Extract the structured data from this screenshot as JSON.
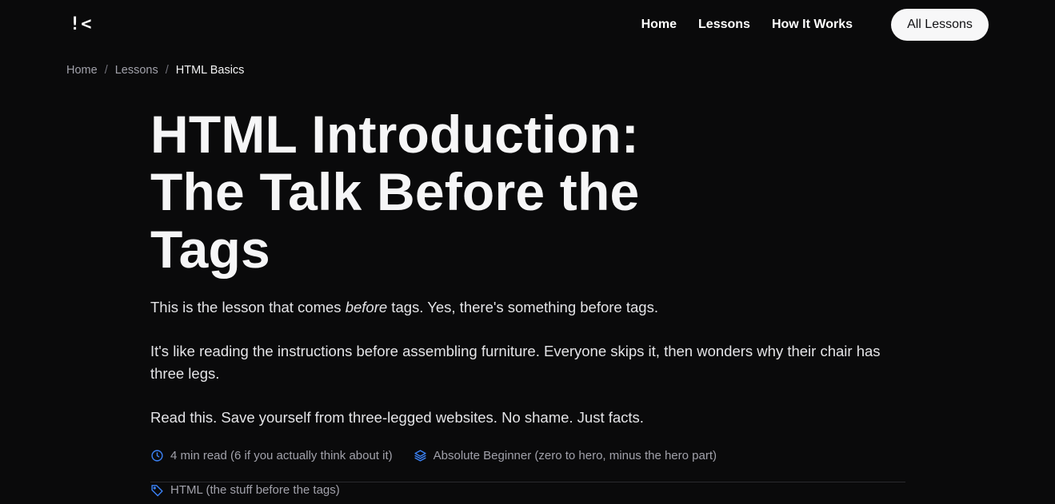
{
  "header": {
    "logo_text": "!<",
    "nav": [
      "Home",
      "Lessons",
      "How It Works"
    ],
    "cta_label": "All Lessons"
  },
  "breadcrumb": {
    "items": [
      "Home",
      "Lessons"
    ],
    "current": "HTML Basics"
  },
  "article": {
    "title": "HTML Introduction: The Talk Before the Tags",
    "intro": {
      "p1_before": "This is the lesson that comes ",
      "p1_em": "before",
      "p1_after": " tags. Yes, there's something before tags.",
      "p2": "It's like reading the instructions before assembling furniture. Everyone skips it, then wonders why their chair has three legs.",
      "p3": "Read this. Save yourself from three-legged websites. No shame. Just facts."
    },
    "meta": {
      "read_time": "4 min read (6 if you actually think about it)",
      "level": "Absolute Beginner (zero to hero, minus the hero part)",
      "tag": "HTML (the stuff before the tags)"
    }
  },
  "icons": {
    "clock": "clock-icon",
    "layers": "layers-icon",
    "tag": "tag-icon"
  },
  "colors": {
    "background": "#0a0a0b",
    "accent_icon": "#3b82f6",
    "muted_text": "#a1a1aa",
    "cta_bg": "#f7f7f8"
  }
}
